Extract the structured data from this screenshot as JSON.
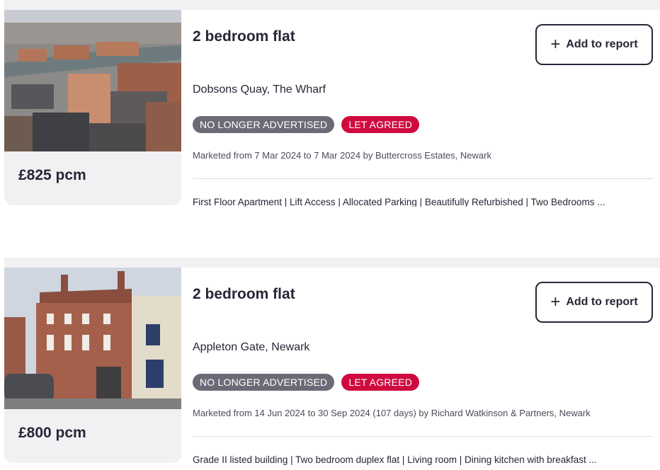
{
  "listings": [
    {
      "title": "2 bedroom flat",
      "address": "Dobsons Quay, The Wharf",
      "price": "£825 pcm",
      "add_button_label": "Add to report",
      "badges": [
        "NO LONGER ADVERTISED",
        "LET AGREED"
      ],
      "marketed": "Marketed from 7 Mar 2024 to 7 Mar 2024 by Buttercross Estates, Newark",
      "features": "First Floor Apartment | Lift Access | Allocated Parking | Beautifully Refurbished | Two Bedrooms ..."
    },
    {
      "title": "2 bedroom flat",
      "address": "Appleton Gate, Newark",
      "price": "£800 pcm",
      "add_button_label": "Add to report",
      "badges": [
        "NO LONGER ADVERTISED",
        "LET AGREED"
      ],
      "marketed": "Marketed from 14 Jun 2024 to 30 Sep 2024 (107 days) by Richard Watkinson & Partners, Newark",
      "features": "Grade II listed building | Two bedroom duplex flat | Living room | Dining kitchen with breakfast ..."
    }
  ],
  "colors": {
    "text": "#262637",
    "badge_grey": "#6b6b78",
    "badge_red": "#cf0a3f",
    "panel_bg": "#f1f1f4"
  },
  "icons": {
    "add": "plus-icon"
  }
}
